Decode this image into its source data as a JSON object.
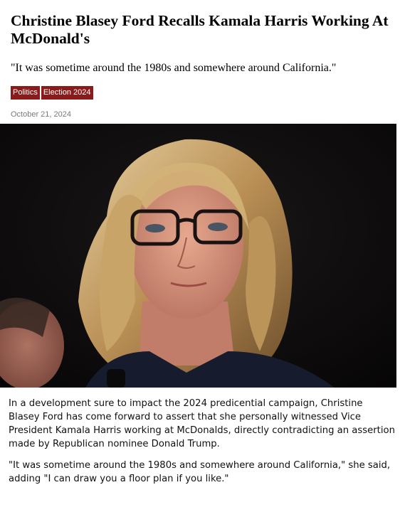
{
  "article": {
    "headline": "Christine Blasey Ford Recalls Kamala Harris Working At McDonald's",
    "subheadline": "\"It was sometime around the 1980s and somewhere around California.\"",
    "tags": [
      "Politics",
      "Election 2024"
    ],
    "date": "October 21, 2024",
    "paragraphs": [
      "In a development sure to impact the 2024 predicential campaign, Christine Blasey Ford has come forward to assert that she personally witnessed Vice President Kamala Harris working at McDonalds, directly contradicting an assertion made by Republican nominee Donald Trump.",
      "\"It was sometime around the 1980s and somewhere around California,\" she said, adding \"I can draw you a floor plan if you like.\""
    ]
  },
  "colors": {
    "tag_background": "#8b1a1a",
    "tag_text": "#ffffff",
    "date_text": "#7a7a7a",
    "photo_background": "#0e0c0d"
  }
}
